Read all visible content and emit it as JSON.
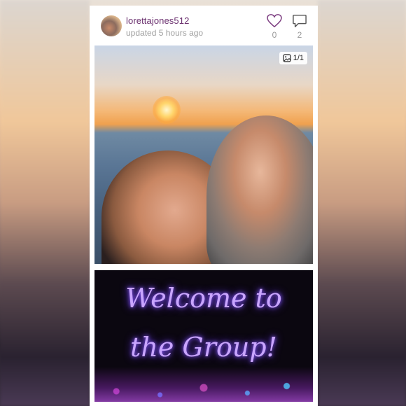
{
  "post": {
    "username": "lorettajones512",
    "updated": "updated 5 hours ago",
    "likes": "0",
    "comments": "2",
    "image_counter": "1/1"
  },
  "graphic": {
    "line1": "Welcome to",
    "line2": "the Group!"
  },
  "icons": {
    "like": "heart-icon",
    "comment": "comment-bubble-icon",
    "gallery": "image-gallery-icon"
  },
  "colors": {
    "username": "#6a2f6e",
    "neon_text": "#c9a5ff"
  }
}
